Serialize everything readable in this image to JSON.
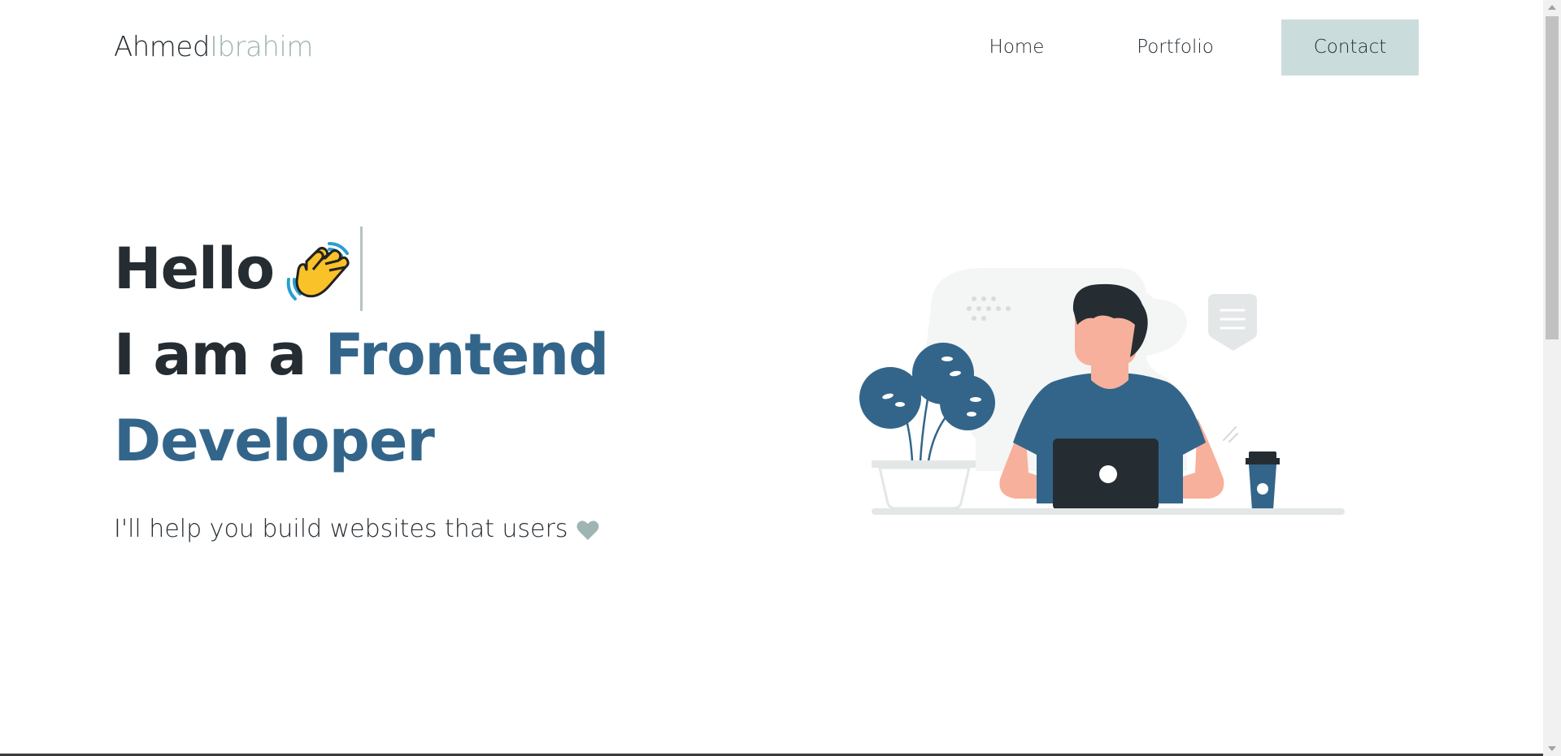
{
  "header": {
    "logo_first": "Ahmed",
    "logo_last": "Ibrahim",
    "nav": {
      "home": "Home",
      "portfolio": "Portfolio",
      "contact": "Contact"
    }
  },
  "hero": {
    "greeting": "Hello",
    "greeting_icon": "waving-hand-icon",
    "line2_prefix": "I am a ",
    "line2_accent": "Frontend",
    "line3": "Developer",
    "tagline": "I'll help you build websites that users",
    "tagline_icon": "heart-icon"
  },
  "colors": {
    "text_dark": "#252d33",
    "accent_blue": "#33658a",
    "logo_muted": "#9fb5b3",
    "contact_button_bg": "#cbdcdc",
    "heart": "#9fb5b3"
  },
  "illustration": {
    "icon": "developer-at-laptop-illustration"
  }
}
